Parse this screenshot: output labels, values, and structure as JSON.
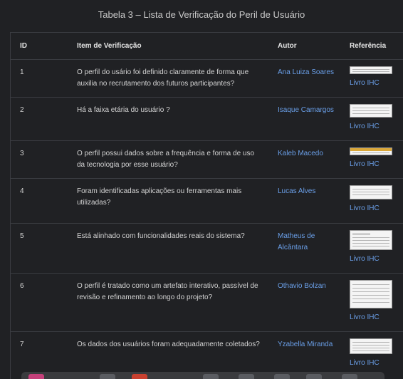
{
  "caption": "Tabela 3 – Lista de Verificação do Peril de Usuário",
  "headers": {
    "id": "ID",
    "item": "Item de Verificação",
    "autor": "Autor",
    "referencia": "Referência"
  },
  "rows": [
    {
      "id": "1",
      "item": "O perfil do usário foi definido claramente de forma que auxilia no recrutamento dos futuros participantes?",
      "autor": "Ana Luiza Soares",
      "ref": "Livro IHC"
    },
    {
      "id": "2",
      "item": "Há a faixa etária do usuário ?",
      "autor": "Isaque Camargos",
      "ref": "Livro IHC"
    },
    {
      "id": "3",
      "item": "O perfil possui dados sobre a frequência e forma de uso da tecnologia por esse usuário?",
      "autor": "Kaleb Macedo",
      "ref": "Livro IHC"
    },
    {
      "id": "4",
      "item": "Foram identificadas aplicações ou ferramentas mais utilizadas?",
      "autor": "Lucas Alves",
      "ref": "Livro IHC"
    },
    {
      "id": "5",
      "item": "Está alinhado com funcionalidades reais do sistema?",
      "autor": "Matheus de Alcântara",
      "ref": "Livro IHC"
    },
    {
      "id": "6",
      "item": "O perfil é tratado como um artefato interativo, passível de revisão e refinamento ao longo do projeto?",
      "autor": "Othavio Bolzan",
      "ref": "Livro IHC"
    },
    {
      "id": "7",
      "item": "Os dados dos usuários foram adequadamente coletados?",
      "autor": "Yzabella Miranda",
      "ref": "Livro IHC"
    }
  ]
}
